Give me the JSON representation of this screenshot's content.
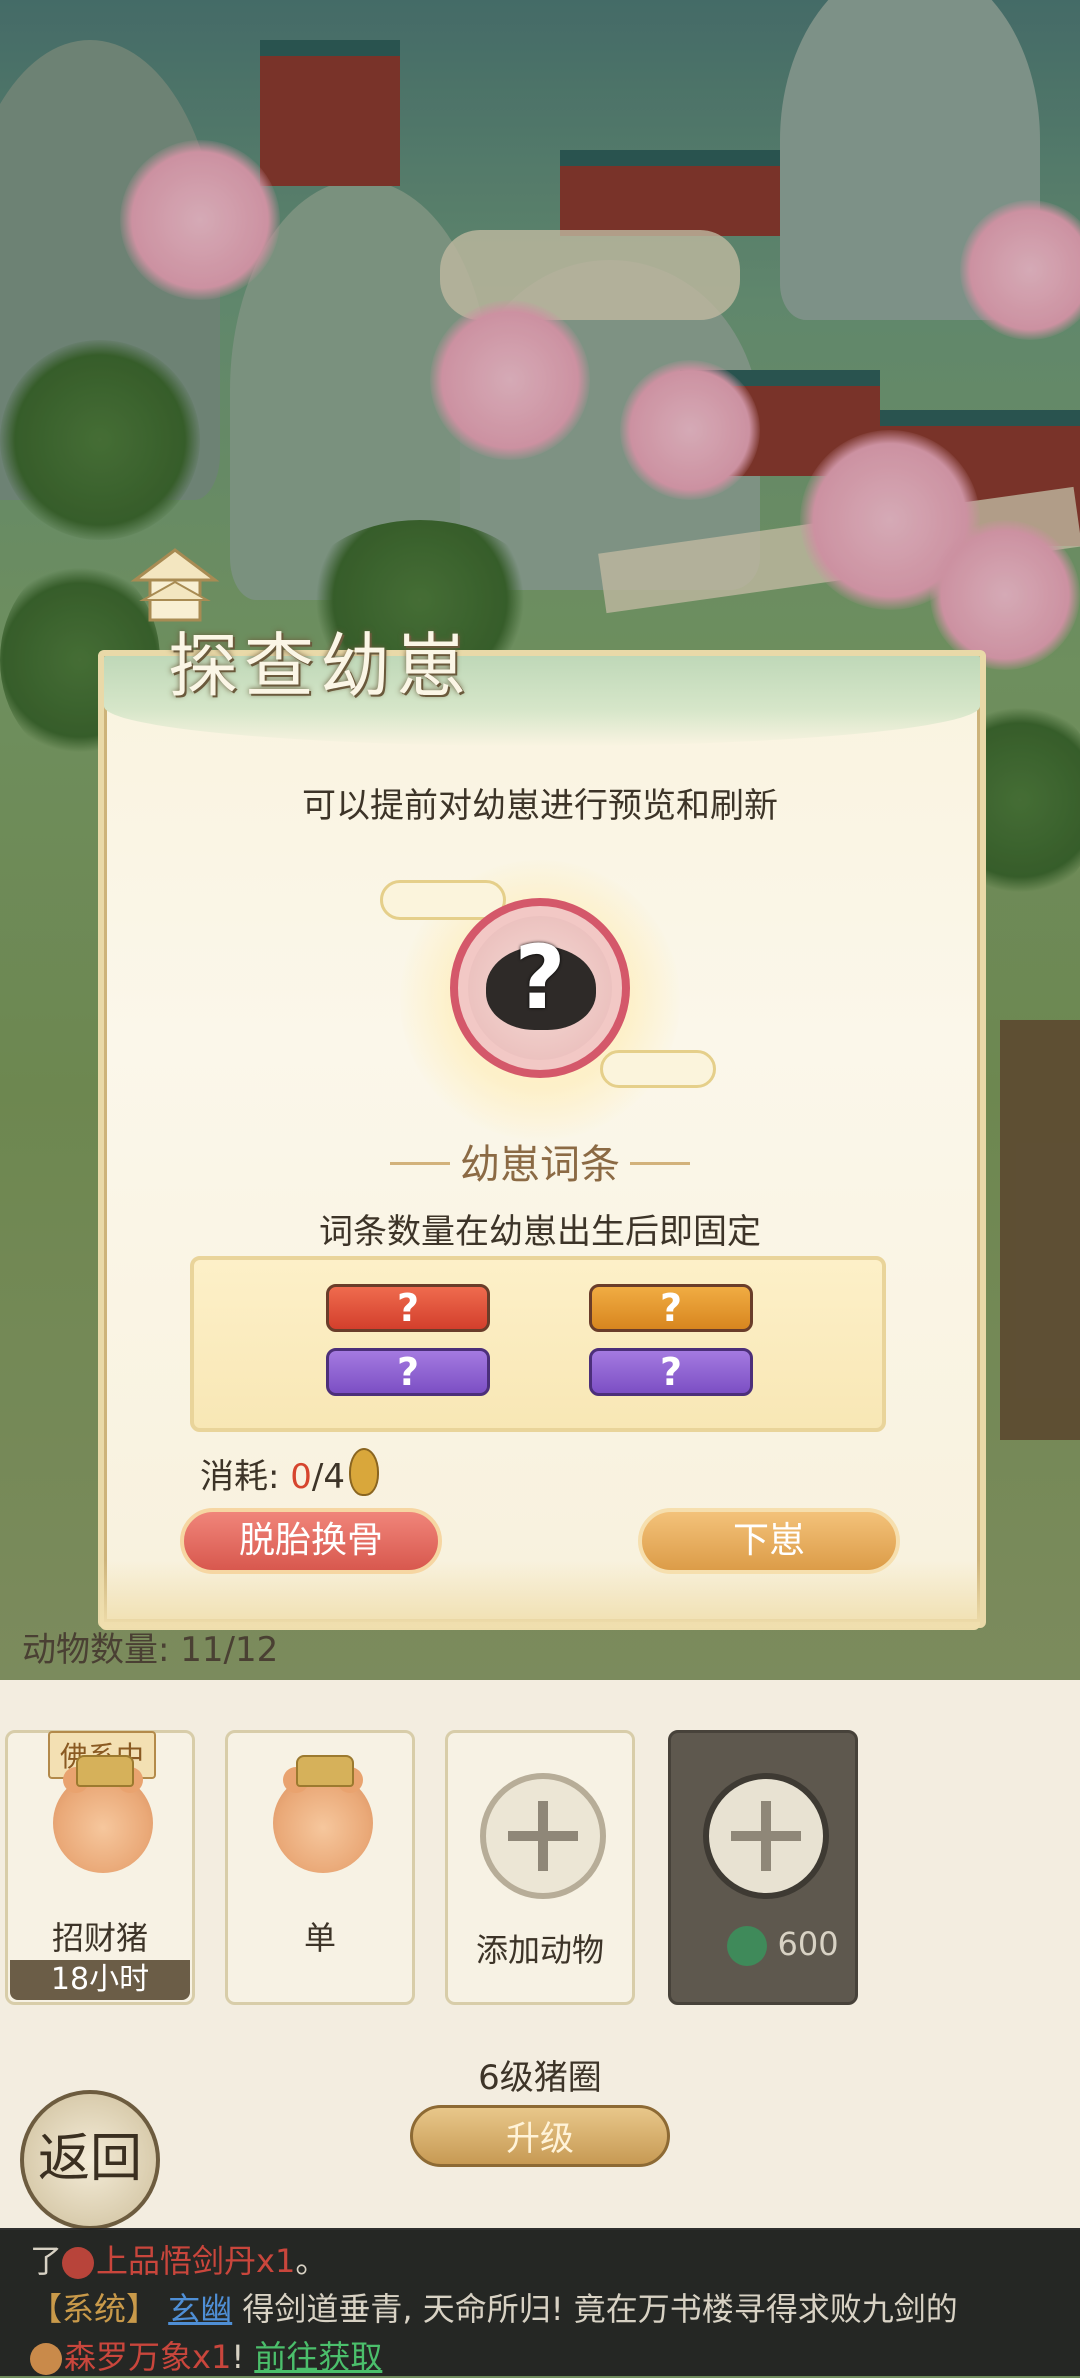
{
  "modal": {
    "title": "探查幼崽",
    "subtitle": "可以提前对幼崽进行预览和刷新",
    "mystery_mark": "?",
    "section_title": "幼崽词条",
    "traits_note": "词条数量在幼崽出生后即固定",
    "traits": [
      "?",
      "?",
      "?",
      "?"
    ],
    "cost_label": "消耗:",
    "cost_current": "0",
    "cost_total": "/4",
    "reroll_button": "脱胎换骨",
    "confirm_button": "下崽"
  },
  "animal_count": "动物数量: 11/12",
  "slots": [
    {
      "tag": "佛系中",
      "label": "招财猪",
      "timer": "18小时"
    },
    {
      "label": "单"
    },
    {
      "label": "添加动物"
    },
    {
      "price": "600"
    }
  ],
  "pen": {
    "level": "6级猪圈",
    "upgrade_button": "升级"
  },
  "back_button": "返回",
  "chat": {
    "line1_prefix": "了",
    "line1_item": "上品悟剑丹x1",
    "line1_suffix": "。",
    "line2_tag": "【系统】",
    "line2_user": "玄幽",
    "line2_text": "得剑道垂青, 天命所归! 竟在万书楼寻得求败九剑的",
    "line3_item": "森罗万象x1",
    "line3_mid": "!",
    "line3_link": "前往获取"
  },
  "colors": {
    "accent_red": "#d6452e",
    "gold": "#dc9c48",
    "purple": "#7c4fc4"
  }
}
